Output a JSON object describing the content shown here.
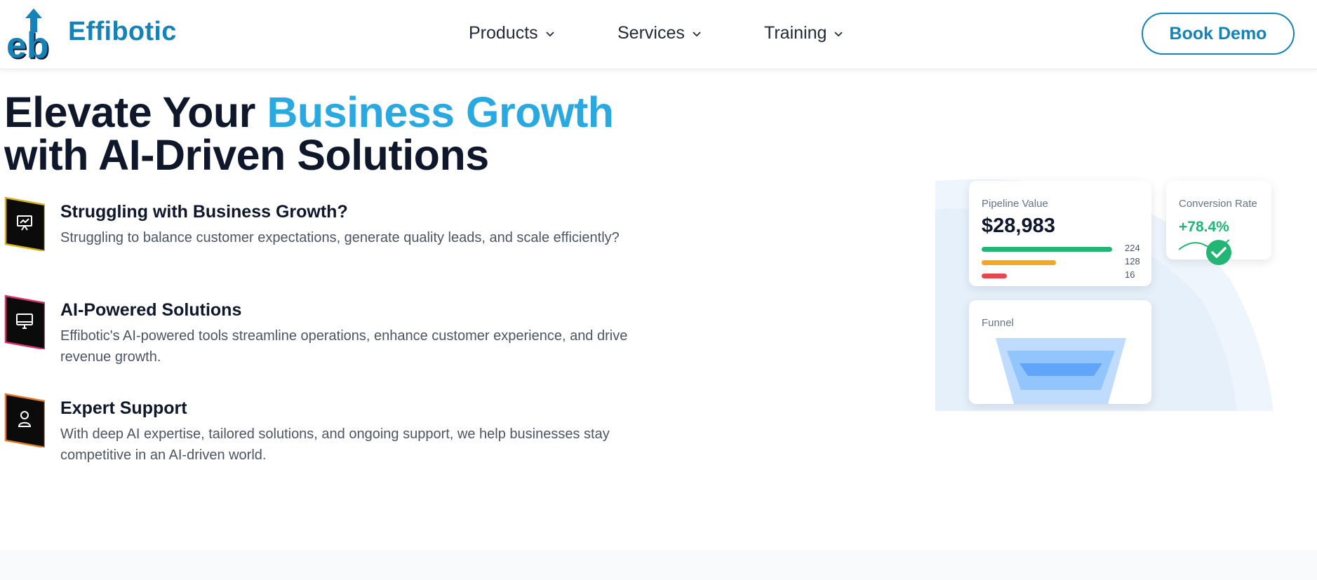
{
  "header": {
    "brand": "Effibotic",
    "logo_text": "eb",
    "nav": [
      {
        "label": "Products",
        "icon": "chevron-down-icon"
      },
      {
        "label": "Services",
        "icon": "chevron-down-icon"
      },
      {
        "label": "Training",
        "icon": "chevron-down-icon"
      }
    ],
    "cta_label": "Book Demo"
  },
  "hero": {
    "title_part1": "Elevate Your ",
    "title_accent": "Business Growth",
    "title_part2": "with AI-Driven Solutions"
  },
  "features": [
    {
      "title": "Struggling with Business Growth?",
      "description": "Struggling to balance customer expectations, generate quality leads, and scale efficiently?",
      "icon": "presentation-chart-icon",
      "frame_color": "#d4b11b"
    },
    {
      "title": "AI-Powered Solutions",
      "description": "Effibotic's AI-powered tools streamline operations, enhance customer experience, and drive revenue growth.",
      "icon": "monitor-icon",
      "frame_color": "#d6336c"
    },
    {
      "title": "Expert Support",
      "description": "With deep AI expertise, tailored solutions, and ongoing support, we help businesses stay competitive in an AI-driven world.",
      "icon": "user-icon",
      "frame_color": "#e07b2a"
    }
  ],
  "dashboard": {
    "pipeline": {
      "label": "Pipeline Value",
      "value": "$28,983",
      "bars": [
        {
          "value": 224,
          "label": "224",
          "color": "#22b573"
        },
        {
          "value": 128,
          "label": "128",
          "color": "#f5a623"
        },
        {
          "value": 16,
          "label": "16",
          "color": "#e5484d"
        }
      ]
    },
    "conversion": {
      "label": "Conversion Rate",
      "value": "+78.4%",
      "icon": "check-circle-icon"
    },
    "funnel": {
      "label": "Funnel"
    }
  },
  "colors": {
    "brand": "#1582b8",
    "accent": "#2aa8e0",
    "text": "#0f172a",
    "muted": "#4b5563"
  }
}
